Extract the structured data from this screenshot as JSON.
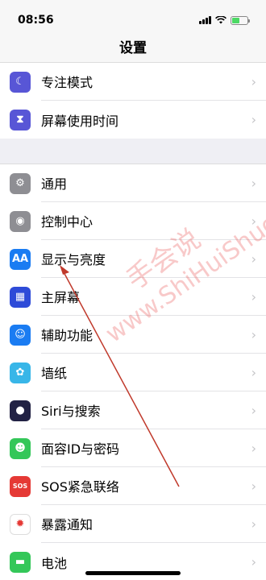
{
  "status": {
    "time": "08:56"
  },
  "nav": {
    "title": "设置"
  },
  "group1": [
    {
      "label": "专注模式",
      "icon": "moon-icon",
      "color": "#5856d6",
      "glyph": "☾"
    },
    {
      "label": "屏幕使用时间",
      "icon": "hourglass-icon",
      "color": "#5856d6",
      "glyph": "⧗"
    }
  ],
  "group2": [
    {
      "label": "通用",
      "icon": "gear-icon",
      "color": "#8e8e93",
      "glyph": "⚙"
    },
    {
      "label": "控制中心",
      "icon": "toggles-icon",
      "color": "#8e8e93",
      "glyph": "◉"
    },
    {
      "label": "显示与亮度",
      "icon": "text-size-icon",
      "color": "#1a7cf2",
      "glyph": "AA"
    },
    {
      "label": "主屏幕",
      "icon": "grid-icon",
      "color": "#2e4bd8",
      "glyph": "▦"
    },
    {
      "label": "辅助功能",
      "icon": "accessibility-icon",
      "color": "#1a7cf2",
      "glyph": "☺"
    },
    {
      "label": "墙纸",
      "icon": "wallpaper-icon",
      "color": "#38b6e8",
      "glyph": "✿"
    },
    {
      "label": "Siri与搜索",
      "icon": "siri-icon",
      "color": "#222244",
      "glyph": "●"
    },
    {
      "label": "面容ID与密码",
      "icon": "face-id-icon",
      "color": "#34c759",
      "glyph": "☻"
    },
    {
      "label": "SOS紧急联络",
      "icon": "sos-icon",
      "color": "#e53935",
      "glyph": "SOS"
    },
    {
      "label": "暴露通知",
      "icon": "exposure-icon",
      "color": "#ffffff",
      "glyph": "✹"
    },
    {
      "label": "电池",
      "icon": "battery-icon",
      "color": "#34c759",
      "glyph": "▬"
    }
  ],
  "chevron": "›",
  "watermark": {
    "line1": "手会说",
    "line2": "www.ShiHuiShuo.Com"
  },
  "colors": {
    "accent": "#e53935",
    "background": "#efeff4"
  }
}
